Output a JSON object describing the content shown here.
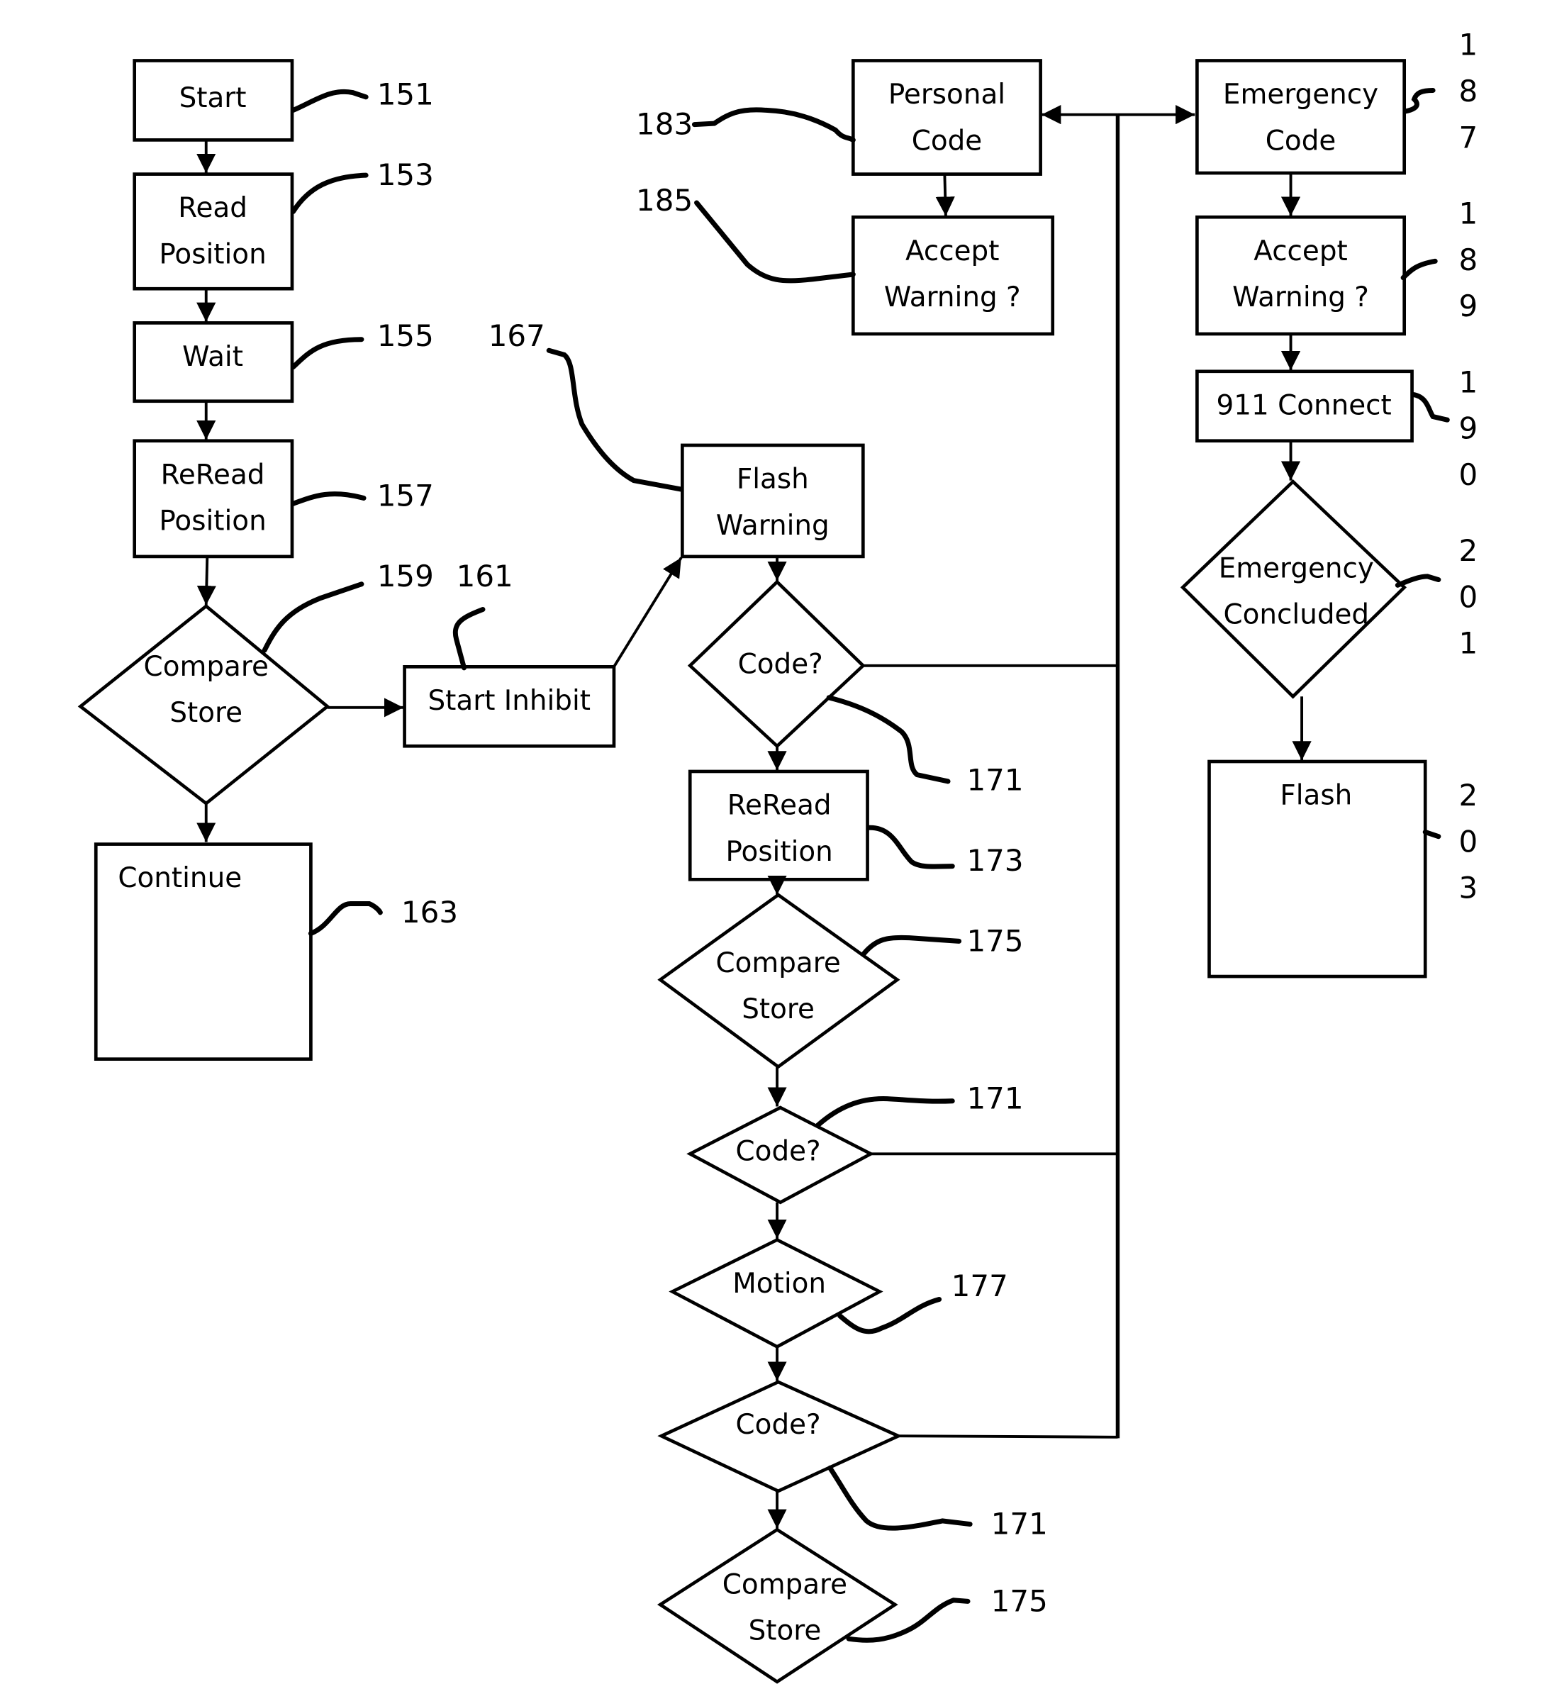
{
  "diagram": {
    "type": "flowchart",
    "background": "#ffffff",
    "stroke_color": "#000000",
    "nodes": {
      "start": {
        "shape": "rect",
        "lines": [
          "Start"
        ],
        "ref": "151"
      },
      "read_position": {
        "shape": "rect",
        "lines": [
          "Read",
          "Position"
        ],
        "ref": "153"
      },
      "wait": {
        "shape": "rect",
        "lines": [
          "Wait"
        ],
        "ref": "155"
      },
      "reread_position_1": {
        "shape": "rect",
        "lines": [
          "ReRead",
          "Position"
        ],
        "ref": "157"
      },
      "compare_store_1": {
        "shape": "diamond",
        "lines": [
          "Compare",
          "Store"
        ],
        "ref": "159"
      },
      "start_inhibit": {
        "shape": "rect",
        "lines": [
          "Start Inhibit"
        ],
        "ref": "161"
      },
      "continue": {
        "shape": "rect",
        "lines": [
          "Continue"
        ],
        "ref": "163"
      },
      "flash_warning": {
        "shape": "rect",
        "lines": [
          "Flash",
          "Warning"
        ],
        "ref": "167"
      },
      "code_1": {
        "shape": "diamond",
        "lines": [
          "Code?"
        ],
        "ref": "171"
      },
      "reread_position_2": {
        "shape": "rect",
        "lines": [
          "ReRead",
          "Position"
        ],
        "ref": "173"
      },
      "compare_store_2": {
        "shape": "diamond",
        "lines": [
          "Compare",
          "Store"
        ],
        "ref": "175"
      },
      "code_2": {
        "shape": "diamond",
        "lines": [
          "Code?"
        ],
        "ref": "171"
      },
      "motion": {
        "shape": "diamond",
        "lines": [
          "Motion"
        ],
        "ref": "177"
      },
      "code_3": {
        "shape": "diamond",
        "lines": [
          "Code?"
        ],
        "ref": "171"
      },
      "compare_store_3": {
        "shape": "diamond",
        "lines": [
          "Compare",
          "Store"
        ],
        "ref": "175"
      },
      "personal_code": {
        "shape": "rect",
        "lines": [
          "Personal",
          "Code"
        ],
        "ref": "183"
      },
      "accept_warning_1": {
        "shape": "rect",
        "lines": [
          "Accept",
          "Warning ?"
        ],
        "ref": "185"
      },
      "emergency_code": {
        "shape": "rect",
        "lines": [
          "Emergency",
          "Code"
        ],
        "ref": "187",
        "ref_vertical": [
          "1",
          "8",
          "7"
        ]
      },
      "accept_warning_2": {
        "shape": "rect",
        "lines": [
          "Accept",
          "Warning  ?"
        ],
        "ref": "189",
        "ref_vertical": [
          "1",
          "8",
          "9"
        ]
      },
      "connect_911": {
        "shape": "rect",
        "lines": [
          "911 Connect"
        ],
        "ref": "190",
        "ref_vertical": [
          "1",
          "9",
          "0"
        ]
      },
      "emergency_concluded": {
        "shape": "diamond",
        "lines": [
          "Emergency",
          "Concluded"
        ],
        "ref": "201",
        "ref_vertical": [
          "2",
          "0",
          "1"
        ]
      },
      "flash": {
        "shape": "rect",
        "lines": [
          "Flash"
        ],
        "ref": "203",
        "ref_vertical": [
          "2",
          "0",
          "3"
        ]
      }
    },
    "edges": [
      {
        "from": "start",
        "to": "read_position",
        "arrow": true
      },
      {
        "from": "read_position",
        "to": "wait",
        "arrow": true
      },
      {
        "from": "wait",
        "to": "reread_position_1",
        "arrow": true
      },
      {
        "from": "reread_position_1",
        "to": "compare_store_1",
        "arrow": true
      },
      {
        "from": "compare_store_1",
        "to": "start_inhibit",
        "arrow": true
      },
      {
        "from": "compare_store_1",
        "to": "continue",
        "arrow": true
      },
      {
        "from": "start_inhibit",
        "to": "flash_warning",
        "arrow": true
      },
      {
        "from": "flash_warning",
        "to": "code_1",
        "arrow": true
      },
      {
        "from": "code_1",
        "to": "reread_position_2",
        "arrow": true
      },
      {
        "from": "reread_position_2",
        "to": "compare_store_2",
        "arrow": true
      },
      {
        "from": "compare_store_2",
        "to": "code_2",
        "arrow": true
      },
      {
        "from": "code_2",
        "to": "motion",
        "arrow": true
      },
      {
        "from": "motion",
        "to": "code_3",
        "arrow": true
      },
      {
        "from": "code_3",
        "to": "compare_store_3",
        "arrow": true
      },
      {
        "from": "code_1",
        "to": "code_bus",
        "arrow": false
      },
      {
        "from": "code_2",
        "to": "code_bus",
        "arrow": false
      },
      {
        "from": "code_3",
        "to": "code_bus",
        "arrow": false
      },
      {
        "from": "code_bus",
        "to": "personal_code",
        "arrow": true
      },
      {
        "from": "code_bus",
        "to": "emergency_code",
        "arrow": true
      },
      {
        "from": "personal_code",
        "to": "accept_warning_1",
        "arrow": true
      },
      {
        "from": "emergency_code",
        "to": "accept_warning_2",
        "arrow": true
      },
      {
        "from": "accept_warning_2",
        "to": "connect_911",
        "arrow": true
      },
      {
        "from": "connect_911",
        "to": "emergency_concluded",
        "arrow": true
      },
      {
        "from": "emergency_concluded",
        "to": "flash",
        "arrow": true
      }
    ]
  }
}
